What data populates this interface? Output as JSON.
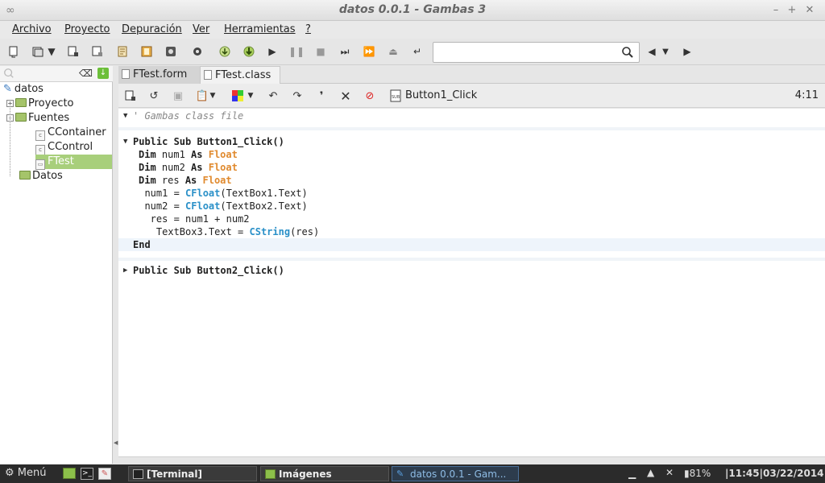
{
  "window": {
    "title": "datos 0.0.1 - Gambas 3"
  },
  "menu": [
    "Archivo",
    "Proyecto",
    "Depuración",
    "Ver",
    "Herramientas",
    "?"
  ],
  "search": {
    "value": "",
    "placeholder": ""
  },
  "project_tree": {
    "root": "datos",
    "items": [
      {
        "label": "Proyecto",
        "type": "folder"
      },
      {
        "label": "Fuentes",
        "type": "folder"
      },
      {
        "label": "CContainer",
        "type": "class"
      },
      {
        "label": "CControl",
        "type": "class"
      },
      {
        "label": "FTest",
        "type": "form",
        "selected": true
      },
      {
        "label": "Datos",
        "type": "folder"
      }
    ]
  },
  "tabs": [
    {
      "label": "FTest.form",
      "active": false
    },
    {
      "label": "FTest.class",
      "active": true
    }
  ],
  "editor_toolbar": {
    "procedure": "Button1_Click",
    "position": "4:11"
  },
  "code": {
    "comment": "' Gambas class file",
    "sub1_header": [
      "Public Sub ",
      "Button1_Click()"
    ],
    "lines": [
      {
        "kw": "Dim",
        "rest": " num1 ",
        "as": "As",
        "type": "Float"
      },
      {
        "kw": "Dim",
        "rest": " num2 ",
        "as": "As",
        "type": "Float"
      },
      {
        "kw": "Dim",
        "rest": " res ",
        "as": "As",
        "type": "Float"
      }
    ],
    "assign1": [
      "  num1 = ",
      "CFloat",
      "(TextBox1.Text)"
    ],
    "assign2": [
      "  num2 = ",
      "CFloat",
      "(TextBox2.Text)"
    ],
    "assign3": "   res = num1 + num2",
    "assign4": [
      "    TextBox3.Text = ",
      "CString",
      "(res)"
    ],
    "end": "End",
    "sub2_header": [
      "Public Sub ",
      "Button2_Click()"
    ]
  },
  "taskbar": {
    "menu_label": "Menú",
    "tasks": [
      "[Terminal]",
      "Imágenes",
      "datos 0.0.1 - Gam..."
    ],
    "battery": "81%",
    "clock": "|11:45|03/22/2014|"
  }
}
